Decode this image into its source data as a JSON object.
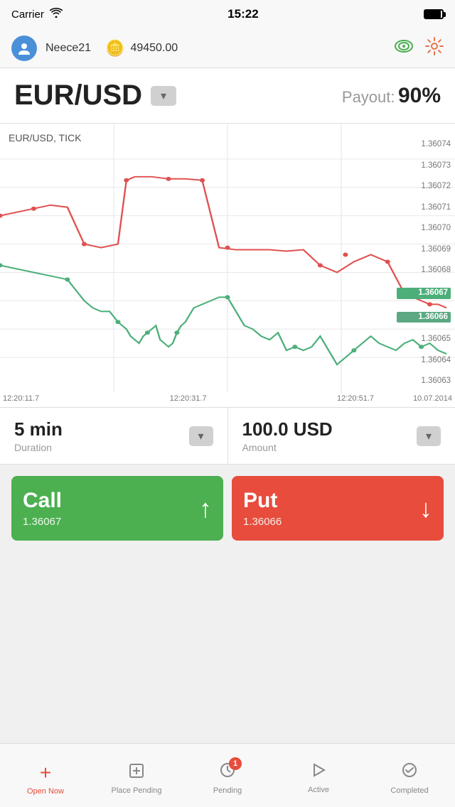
{
  "statusBar": {
    "carrier": "Carrier",
    "time": "15:22",
    "wifi": "📶"
  },
  "header": {
    "username": "Neece21",
    "balance": "49450.00",
    "settingsIcon": "⚙",
    "signalIcon": "((o))"
  },
  "instrument": {
    "name": "EUR/USD",
    "payoutLabel": "Payout:",
    "payoutValue": "90%"
  },
  "chart": {
    "label": "EUR/USD, TICK",
    "prices": [
      {
        "value": "1.36074",
        "highlight": false
      },
      {
        "value": "1.36073",
        "highlight": false
      },
      {
        "value": "1.36072",
        "highlight": false
      },
      {
        "value": "1.36071",
        "highlight": false
      },
      {
        "value": "1.36070",
        "highlight": false
      },
      {
        "value": "1.36069",
        "highlight": false
      },
      {
        "value": "1.36068",
        "highlight": false
      },
      {
        "value": "1.36067",
        "highlight": true,
        "color": "green"
      },
      {
        "value": "1.36066",
        "highlight": true,
        "color": "teal"
      },
      {
        "value": "1.36065",
        "highlight": false
      },
      {
        "value": "1.36064",
        "highlight": false
      },
      {
        "value": "1.36063",
        "highlight": false
      }
    ],
    "timeLabels": [
      "12:20:11.7",
      "12:20:31.7",
      "12:20:51.7"
    ],
    "dateLabel": "10.07.2014"
  },
  "duration": {
    "value": "5 min",
    "label": "Duration"
  },
  "amount": {
    "value": "100.0 USD",
    "label": "Amount"
  },
  "callButton": {
    "label": "Call",
    "price": "1.36067",
    "arrow": "↑"
  },
  "putButton": {
    "label": "Put",
    "price": "1.36066",
    "arrow": "↓"
  },
  "tabBar": {
    "tabs": [
      {
        "id": "open-now",
        "label": "Open Now",
        "icon": "+",
        "active": true
      },
      {
        "id": "place-pending",
        "label": "Place Pending",
        "icon": "⊞",
        "active": false
      },
      {
        "id": "pending",
        "label": "Pending",
        "icon": "🕐",
        "active": false,
        "badge": "1"
      },
      {
        "id": "active",
        "label": "Active",
        "icon": "▷",
        "active": false
      },
      {
        "id": "completed",
        "label": "Completed",
        "icon": "✓",
        "active": false
      }
    ]
  }
}
